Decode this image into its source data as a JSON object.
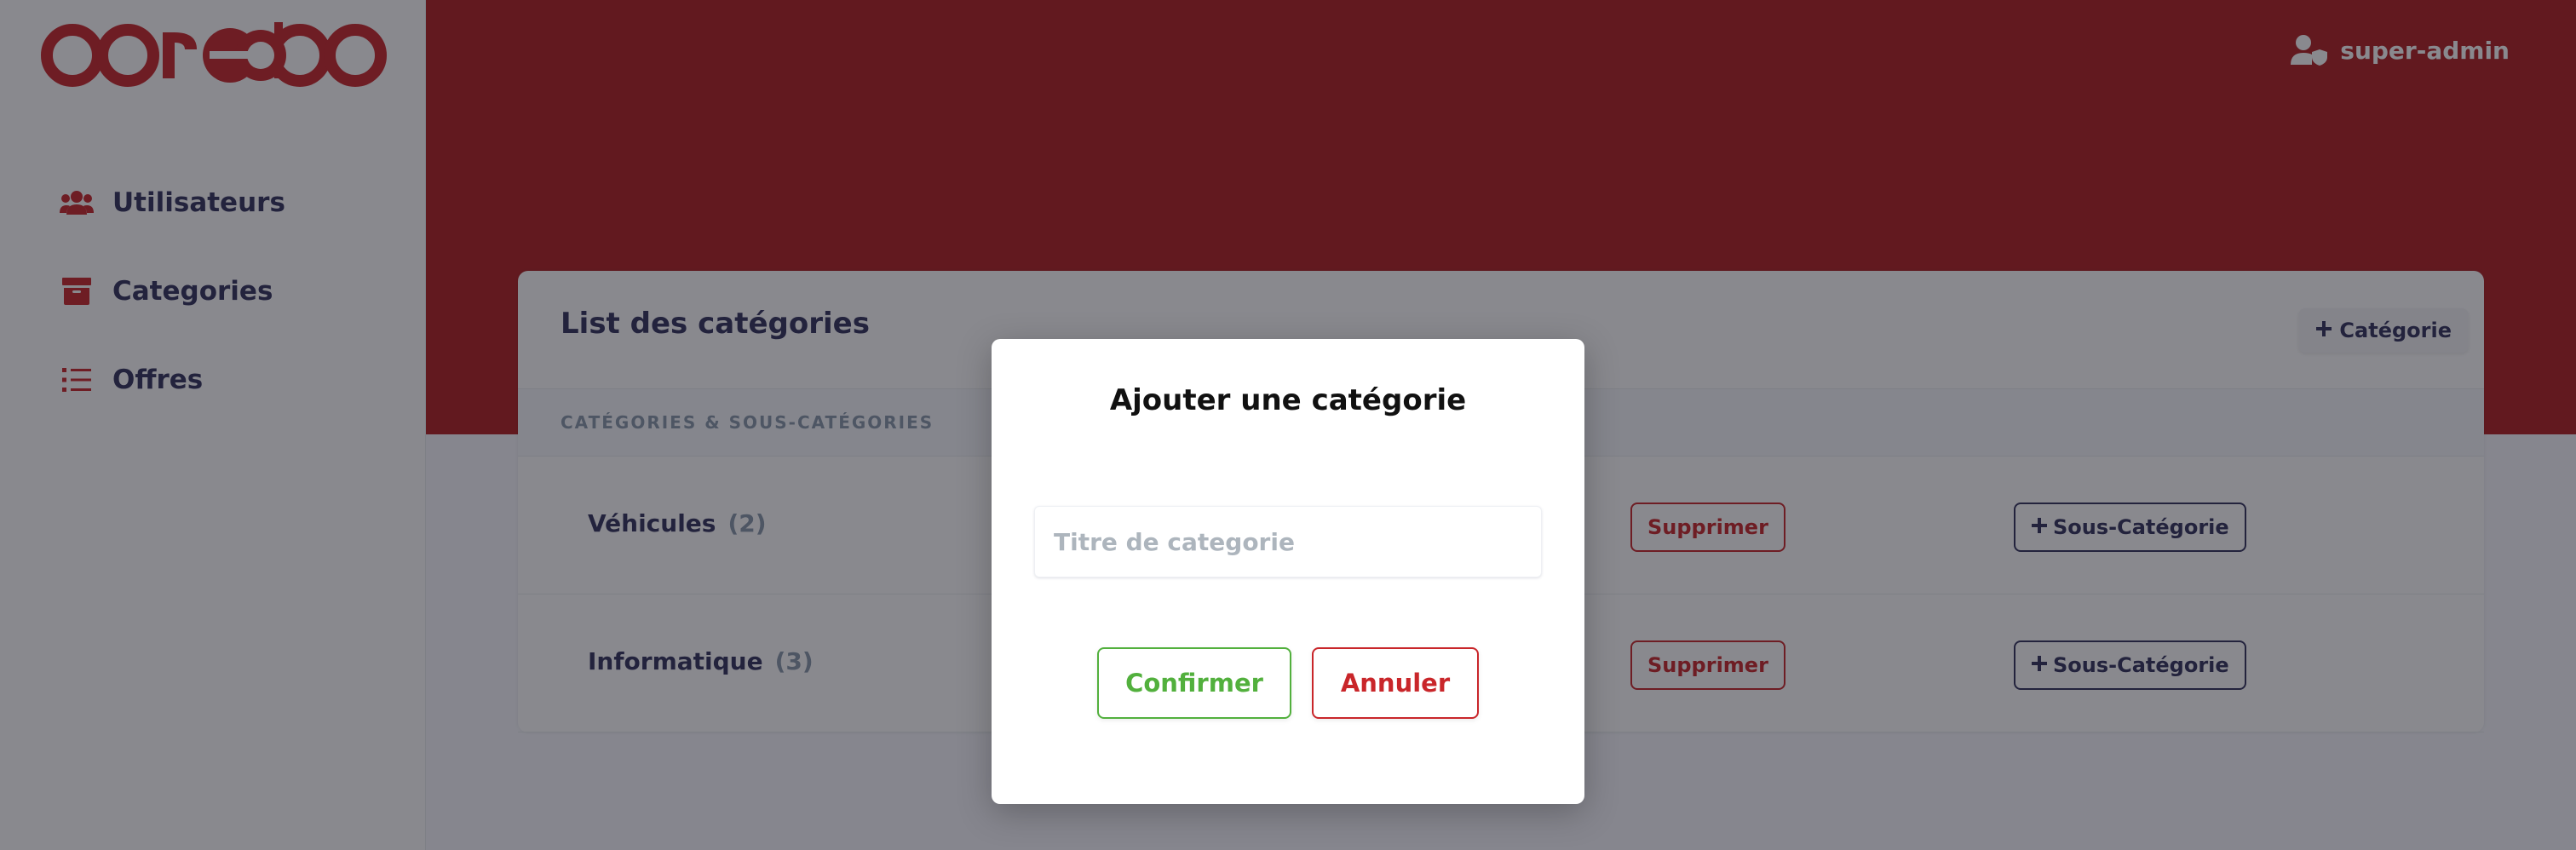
{
  "brand": {
    "logo_text": "ooredoo",
    "primary_color": "#b01f21"
  },
  "sidebar": {
    "items": [
      {
        "label": "Utilisateurs",
        "icon": "users-icon"
      },
      {
        "label": "Categories",
        "icon": "archive-icon"
      },
      {
        "label": "Offres",
        "icon": "list-icon"
      }
    ]
  },
  "header": {
    "user": {
      "name": "super-admin",
      "icon": "user-shield-icon"
    }
  },
  "card": {
    "title": "List des catégories",
    "add_button_label": "Catégorie",
    "table_header": "CATÉGORIES & SOUS-CATÉGORIES",
    "rows": [
      {
        "name": "Véhicules",
        "count": "(2)",
        "delete_label": "Supprimer",
        "add_sub_label": "Sous-Catégorie"
      },
      {
        "name": "Informatique",
        "count": "(3)",
        "delete_label": "Supprimer",
        "add_sub_label": "Sous-Catégorie"
      }
    ]
  },
  "modal": {
    "title": "Ajouter une catégorie",
    "input_placeholder": "Titre de categorie",
    "input_value": "",
    "confirm_label": "Confirmer",
    "cancel_label": "Annuler"
  }
}
